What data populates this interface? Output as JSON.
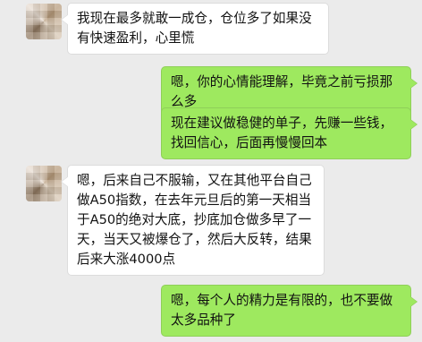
{
  "messages": [
    {
      "side": "left",
      "text": "我现在最多就敢一成仓，仓位多了如果没有快速盈利，心里慌"
    },
    {
      "side": "right",
      "text": "嗯，你的心情能理解，毕竟之前亏损那么多"
    },
    {
      "side": "right",
      "text": "现在建议做稳健的单子，先赚一些钱，找回信心，后面再慢慢回本"
    },
    {
      "side": "left",
      "text": "嗯，后来自己不服输，又在其他平台自己做A50指数，在去年元旦后的第一天相当于A50的绝对大底，抄底加仓做多早了一天，当天又被爆仓了，然后大反转，结果后来大涨4000点"
    },
    {
      "side": "right",
      "text": "嗯，每个人的精力是有限的，也不要做太多品种了"
    }
  ]
}
